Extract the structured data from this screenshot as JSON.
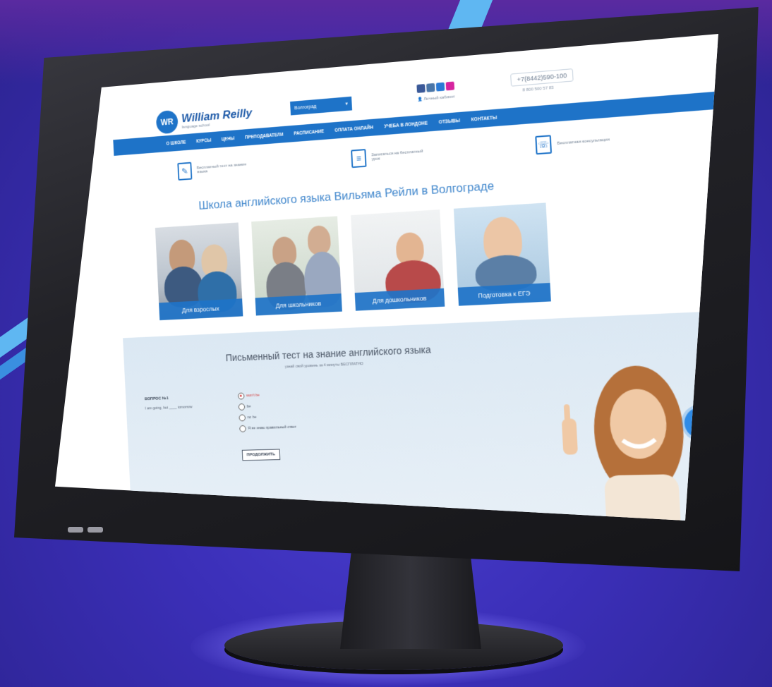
{
  "site": {
    "logo_initials": "WR",
    "logo_name": "William Reilly",
    "logo_sub": "language school",
    "city": "Волгоград",
    "cabinet": "Личный кабинет",
    "phone_main": "+7(8442)590-100",
    "phone_secondary": "8 800 500 57 83"
  },
  "nav": [
    "О ШКОЛЕ",
    "КУРСЫ",
    "ЦЕНЫ",
    "ПРЕПОДАВАТЕЛИ",
    "РАСПИСАНИЕ",
    "ОПЛАТА ОНЛАЙН",
    "УЧЕБА В ЛОНДОНЕ",
    "ОТЗЫВЫ",
    "КОНТАКТЫ"
  ],
  "features": [
    {
      "icon": "clipboard-icon",
      "text": "Бесплатный тест на знание языка"
    },
    {
      "icon": "books-icon",
      "text": "Записаться на бесплатный урок"
    },
    {
      "icon": "consult-icon",
      "text": "Бесплатная консультация"
    }
  ],
  "heading": "Школа английского языка Вильяма Рейли в Волгограде",
  "cards": [
    {
      "label": "Для взрослых"
    },
    {
      "label": "Для школьников"
    },
    {
      "label": "Для дошкольников"
    },
    {
      "label": "Подготовка к ЕГЭ"
    }
  ],
  "test": {
    "title": "Письменный тест на знание английского языка",
    "subtitle": "узнай свой уровень за 4 минуты БЕСПЛАТНО",
    "question_label": "ВОПРОС №1",
    "question_text": "I am going, but ____ tomorrow",
    "answers": [
      {
        "text": "won't be",
        "selected": true
      },
      {
        "text": "be",
        "selected": false
      },
      {
        "text": "no be",
        "selected": false
      },
      {
        "text": "Я не знаю правильный ответ",
        "selected": false
      }
    ],
    "continue_label": "ПРОДОЛЖИТЬ"
  },
  "call_icon": "phone-icon",
  "colors": {
    "brand": "#1e73c8",
    "background": "#3b2fb8",
    "accent_red": "#d23a3a"
  }
}
